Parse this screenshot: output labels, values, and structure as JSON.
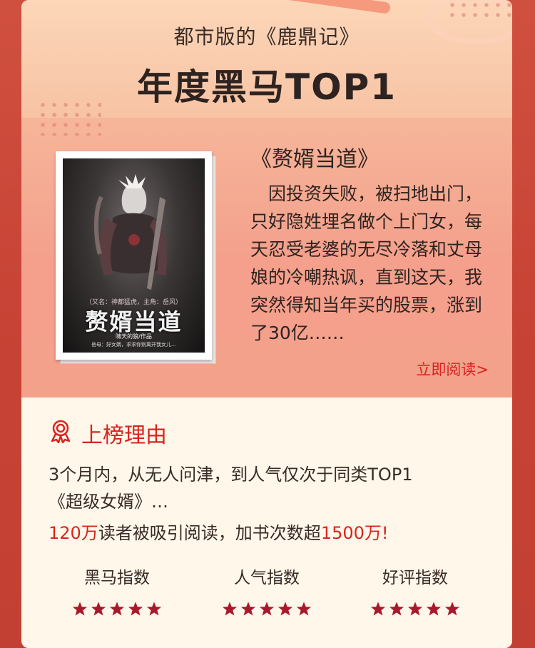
{
  "header": {
    "eyebrow": "都市版的《鹿鼎记》",
    "headline": "年度黑马TOP1"
  },
  "book": {
    "title": "《赘婿当道》",
    "description": "因投资失败，被扫地出门，只好隐姓埋名做个上门女，每天忍受老婆的无尽冷落和丈母娘的冷嘲热讽，直到这天，我突然得知当年买的股票，涨到了30亿……",
    "read_link": "立即阅读>",
    "cover": {
      "subtitle": "（又名：神都猛虎，主角：岳风）",
      "title": "赘婿当道",
      "author": "啸天的狼/作品",
      "tagline": "岳母：好女婿，求求你别离开我女儿…"
    }
  },
  "reason": {
    "title": "上榜理由",
    "line1": "3个月内，从无人问津，到人气仅次于同类TOP1",
    "line2": "《超级女婿》…",
    "line3_a": "120万",
    "line3_b": "读者被吸引阅读，加书次数超",
    "line3_c": "1500万!"
  },
  "ratings": [
    {
      "label": "黑马指数",
      "stars": 5
    },
    {
      "label": "人气指数",
      "stars": 5
    },
    {
      "label": "好评指数",
      "stars": 5
    }
  ],
  "colors": {
    "accent_red": "#d8241f",
    "star": "#a8192b",
    "text_dark": "#2e2320",
    "panel_bg": "#fff7ea"
  }
}
